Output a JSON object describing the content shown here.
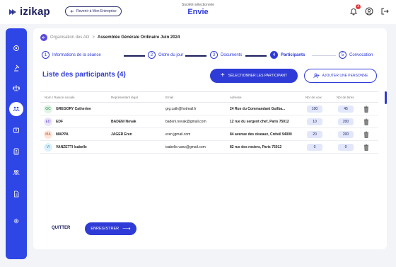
{
  "app": {
    "name": "izikap"
  },
  "header": {
    "back_label": "Revenir à Mon Entreprise",
    "company_caption": "Société sélectionnée",
    "company_name": "Envie",
    "notification_count": "3"
  },
  "breadcrumb": {
    "parent": "Organisation des AG",
    "separator": ">",
    "current": "Assemblée Générale Ordinaire Juin 2024"
  },
  "steps": [
    {
      "num": "1",
      "label": "Informations de la séance"
    },
    {
      "num": "2",
      "label": "Ordre du jour"
    },
    {
      "num": "3",
      "label": "Documents"
    },
    {
      "num": "4",
      "label": "Participants"
    },
    {
      "num": "5",
      "label": "Convocation"
    }
  ],
  "active_step": 4,
  "section": {
    "title": "Liste des participants (4)",
    "select_label": "SÉLECTIONNER LES PARTICIPANT",
    "add_label": "AJOUTER UNE PERSONNE"
  },
  "table": {
    "headers": [
      "Nom / Raison sociale",
      "Représentant légal",
      "Email",
      "Adresse",
      "Nbr de voix",
      "Nbr de titres"
    ],
    "rows": [
      {
        "initials": "GC",
        "name": "GREGORY Catherine",
        "rep": "",
        "email": "grg.cath@hotmail.fr",
        "address": "24 Rue du Commandant Guilba...",
        "votes": "100",
        "titles": "45",
        "avatar_bg": "#dff3e3",
        "avatar_fg": "#2e8b57"
      },
      {
        "initials": "ED",
        "name": "EDF",
        "rep": "BADENI Novak",
        "email": "badeni.novak@gmail.com",
        "address": "12 rue du sergent chef, Paris 75012",
        "votes": "10",
        "titles": "200",
        "avatar_bg": "#ece6fb",
        "avatar_fg": "#6a4bc4"
      },
      {
        "initials": "MA",
        "name": "MAPPA",
        "rep": "JAGER Eren",
        "email": "eren.jgmail.com",
        "address": "84 avenue des oiseaux, Créteil 94000",
        "votes": "20",
        "titles": "200",
        "avatar_bg": "#fde6dc",
        "avatar_fg": "#c5592a"
      },
      {
        "initials": "VI",
        "name": "VANZETTI Isabelle",
        "rep": "",
        "email": "isabelle.vanz@gmail.com",
        "address": "82 rue des rosiers, Paris 75012",
        "votes": "0",
        "titles": "0",
        "avatar_bg": "#def1fb",
        "avatar_fg": "#2a86c4"
      }
    ]
  },
  "footer": {
    "quit_label": "QUITTER",
    "save_label": "ENREGISTRER",
    "save_arrow": "⟶"
  },
  "colors": {
    "primary": "#2f3bd6",
    "sidebar": "#2f46e6",
    "navy": "#1c1f5c",
    "badge": "#e03a3a"
  },
  "sidebar_icons": [
    "settings-icon",
    "gavel-icon",
    "scale-icon",
    "assembly-icon",
    "users-group-icon",
    "contact-card-icon",
    "people-icon",
    "document-icon",
    "gear-icon"
  ]
}
